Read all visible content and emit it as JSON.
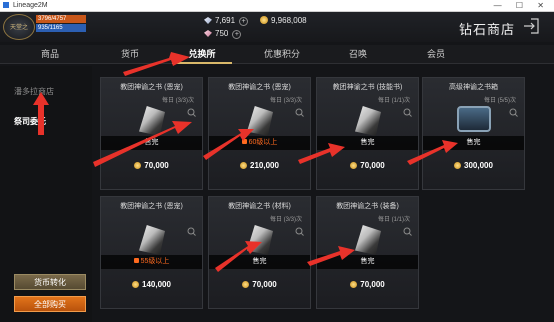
{
  "window": {
    "title": "Lineage2M"
  },
  "player": {
    "hp_text": "3796/4757",
    "mp_text": "935/1165",
    "avatar_text": "天堂之"
  },
  "currencies": {
    "diamond": "7,691",
    "gold": "9,968,008",
    "red_diamond": "750"
  },
  "shop_title": "钻石商店",
  "tabs": [
    {
      "label": "商品"
    },
    {
      "label": "货币"
    },
    {
      "label": "兑换所",
      "active": true
    },
    {
      "label": "优惠积分"
    },
    {
      "label": "召唤"
    },
    {
      "label": "会员"
    }
  ],
  "sidebar": {
    "items": [
      {
        "label": "潘多拉商店"
      },
      {
        "label": "祭司委托",
        "active": true
      }
    ],
    "convert_button": "货币转化",
    "buy_all_button": "全部购买"
  },
  "cards": [
    {
      "name": "教团神谕之书 (恩宠)",
      "limit": "每日 (3/3)次",
      "status": "售完",
      "price": "70,000",
      "item": "book"
    },
    {
      "name": "教团神谕之书 (恩宠)",
      "limit": "每日 (3/3)次",
      "status": "60级以上",
      "price": "210,000",
      "item": "book"
    },
    {
      "name": "教团神谕之书 (技能书)",
      "limit": "每日 (1/1)次",
      "status": "售完",
      "price": "70,000",
      "item": "book"
    },
    {
      "name": "高级神谕之书箱",
      "limit": "每日 (5/5)次",
      "status": "售完",
      "price": "300,000",
      "item": "chest"
    },
    {
      "name": "教团神谕之书 (恩宠)",
      "limit": "",
      "status": "55级以上",
      "price": "140,000",
      "item": "book"
    },
    {
      "name": "教团神谕之书 (材料)",
      "limit": "每日 (3/3)次",
      "status": "售完",
      "price": "70,000",
      "item": "book"
    },
    {
      "name": "教团神谕之书 (装备)",
      "limit": "每日 (1/1)次",
      "status": "售完",
      "price": "70,000",
      "item": "book"
    }
  ],
  "colors": {
    "accent_gold": "#d9b86a",
    "arrow_red": "#e8322a",
    "locked_orange": "#ff6a1f",
    "buy_all_orange": "#e2741b"
  }
}
